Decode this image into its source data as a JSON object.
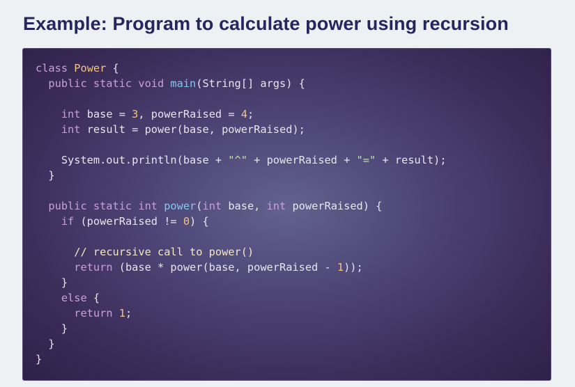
{
  "heading": "Example: Program to calculate power using recursion",
  "colors": {
    "heading": "#25265e",
    "page_background": "#eef1f4",
    "code_background": "#4c4475",
    "keyword": "#c8a0d8",
    "class_name": "#f2c486",
    "function_name": "#86c6f0",
    "number": "#f2c486",
    "string": "#b7e3a0",
    "comment": "#f6e7c4",
    "plain": "#e8e6f0"
  },
  "code_lines": [
    [
      {
        "t": "kw",
        "v": "class"
      },
      {
        "t": "pl",
        "v": " "
      },
      {
        "t": "cls",
        "v": "Power"
      },
      {
        "t": "pl",
        "v": " {"
      }
    ],
    [
      {
        "t": "pl",
        "v": "  "
      },
      {
        "t": "kw",
        "v": "public static void"
      },
      {
        "t": "pl",
        "v": " "
      },
      {
        "t": "fn",
        "v": "main"
      },
      {
        "t": "pl",
        "v": "(String[] args) {"
      }
    ],
    [],
    [
      {
        "t": "pl",
        "v": "    "
      },
      {
        "t": "kw",
        "v": "int"
      },
      {
        "t": "pl",
        "v": " base = "
      },
      {
        "t": "num",
        "v": "3"
      },
      {
        "t": "pl",
        "v": ", powerRaised = "
      },
      {
        "t": "num",
        "v": "4"
      },
      {
        "t": "pl",
        "v": ";"
      }
    ],
    [
      {
        "t": "pl",
        "v": "    "
      },
      {
        "t": "kw",
        "v": "int"
      },
      {
        "t": "pl",
        "v": " result = power(base, powerRaised);"
      }
    ],
    [],
    [
      {
        "t": "pl",
        "v": "    System.out.println(base + "
      },
      {
        "t": "str",
        "v": "\"^\""
      },
      {
        "t": "pl",
        "v": " + powerRaised + "
      },
      {
        "t": "str",
        "v": "\"=\""
      },
      {
        "t": "pl",
        "v": " + result);"
      }
    ],
    [
      {
        "t": "pl",
        "v": "  }"
      }
    ],
    [],
    [
      {
        "t": "pl",
        "v": "  "
      },
      {
        "t": "kw",
        "v": "public static int"
      },
      {
        "t": "pl",
        "v": " "
      },
      {
        "t": "fn",
        "v": "power"
      },
      {
        "t": "pl",
        "v": "("
      },
      {
        "t": "kw",
        "v": "int"
      },
      {
        "t": "pl",
        "v": " base, "
      },
      {
        "t": "kw",
        "v": "int"
      },
      {
        "t": "pl",
        "v": " powerRaised) {"
      }
    ],
    [
      {
        "t": "pl",
        "v": "    "
      },
      {
        "t": "kw",
        "v": "if"
      },
      {
        "t": "pl",
        "v": " (powerRaised != "
      },
      {
        "t": "num",
        "v": "0"
      },
      {
        "t": "pl",
        "v": ") {"
      }
    ],
    [],
    [
      {
        "t": "pl",
        "v": "      "
      },
      {
        "t": "cmt",
        "v": "// recursive call to power()"
      }
    ],
    [
      {
        "t": "pl",
        "v": "      "
      },
      {
        "t": "kw",
        "v": "return"
      },
      {
        "t": "pl",
        "v": " (base * power(base, powerRaised - "
      },
      {
        "t": "num",
        "v": "1"
      },
      {
        "t": "pl",
        "v": "));"
      }
    ],
    [
      {
        "t": "pl",
        "v": "    }"
      }
    ],
    [
      {
        "t": "pl",
        "v": "    "
      },
      {
        "t": "kw",
        "v": "else"
      },
      {
        "t": "pl",
        "v": " {"
      }
    ],
    [
      {
        "t": "pl",
        "v": "      "
      },
      {
        "t": "kw",
        "v": "return"
      },
      {
        "t": "pl",
        "v": " "
      },
      {
        "t": "num",
        "v": "1"
      },
      {
        "t": "pl",
        "v": ";"
      }
    ],
    [
      {
        "t": "pl",
        "v": "    }"
      }
    ],
    [
      {
        "t": "pl",
        "v": "  }"
      }
    ],
    [
      {
        "t": "pl",
        "v": "}"
      }
    ]
  ]
}
